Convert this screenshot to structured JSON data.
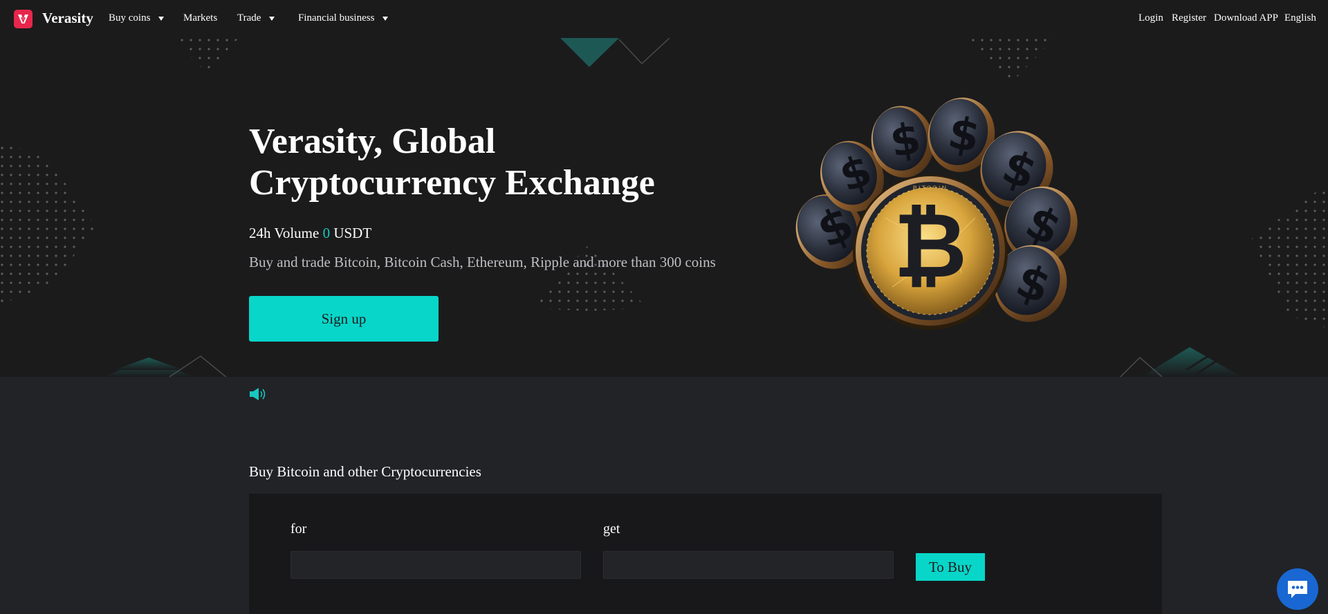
{
  "nav": {
    "brand": "Verasity",
    "logo_icon": "verasity-logo-icon",
    "items": [
      {
        "label": "Buy coins",
        "dropdown": true
      },
      {
        "label": "Markets",
        "dropdown": false
      },
      {
        "label": "Trade",
        "dropdown": true
      },
      {
        "label": "Financial business",
        "dropdown": true
      }
    ],
    "right": {
      "login": "Login",
      "register": "Register",
      "download": "Download APP",
      "language": "English"
    }
  },
  "hero": {
    "title_line1": "Verasity, Global",
    "title_line2": "Cryptocurrency Exchange",
    "volume_label": "24h Volume",
    "volume_value": "0",
    "volume_unit": "USDT",
    "subtitle": "Buy and trade Bitcoin, Bitcoin Cash, Ethereum, Ripple and more than 300 coins",
    "signup_label": "Sign up",
    "coin_text": "BITCOIN"
  },
  "notice": {
    "icon": "speaker-icon"
  },
  "buy": {
    "heading": "Buy Bitcoin and other Cryptocurrencies",
    "for_label": "for",
    "get_label": "get",
    "for_value": "",
    "get_value": "",
    "button_label": "To Buy"
  },
  "chat": {
    "icon": "chat-icon"
  },
  "colors": {
    "accent": "#08d6c9",
    "brand_red": "#e8264b",
    "background": "#1b1b1c",
    "chat_blue": "#1967d2"
  }
}
